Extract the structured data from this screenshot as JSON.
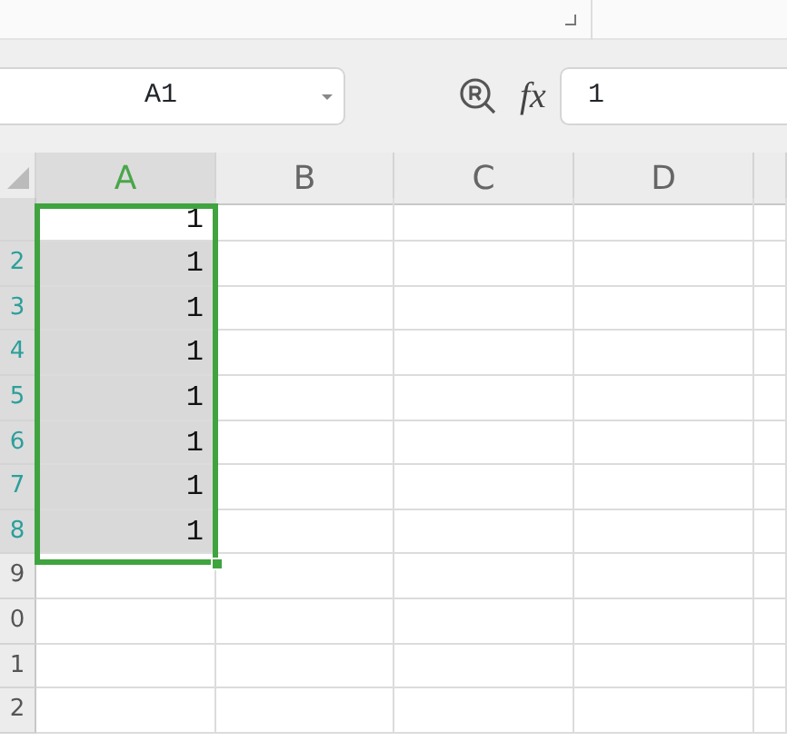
{
  "name_box": {
    "value": "A1"
  },
  "formula_bar": {
    "fx": "fx",
    "value": "1"
  },
  "columns": [
    {
      "label": "A",
      "selected": true
    },
    {
      "label": "B",
      "selected": false
    },
    {
      "label": "C",
      "selected": false
    },
    {
      "label": "D",
      "selected": false
    }
  ],
  "rows": [
    {
      "header": "",
      "active": true,
      "selected": true,
      "cells": [
        "1",
        "",
        "",
        ""
      ]
    },
    {
      "header": "2",
      "active": false,
      "selected": true,
      "cells": [
        "1",
        "",
        "",
        ""
      ]
    },
    {
      "header": "3",
      "active": false,
      "selected": true,
      "cells": [
        "1",
        "",
        "",
        ""
      ]
    },
    {
      "header": "4",
      "active": false,
      "selected": true,
      "cells": [
        "1",
        "",
        "",
        ""
      ]
    },
    {
      "header": "5",
      "active": false,
      "selected": true,
      "cells": [
        "1",
        "",
        "",
        ""
      ]
    },
    {
      "header": "6",
      "active": false,
      "selected": true,
      "cells": [
        "1",
        "",
        "",
        ""
      ]
    },
    {
      "header": "7",
      "active": false,
      "selected": true,
      "cells": [
        "1",
        "",
        "",
        ""
      ]
    },
    {
      "header": "8",
      "active": false,
      "selected": true,
      "cells": [
        "1",
        "",
        "",
        ""
      ]
    },
    {
      "header": "9",
      "active": false,
      "selected": false,
      "cells": [
        "",
        "",
        "",
        ""
      ]
    },
    {
      "header": "0",
      "active": false,
      "selected": false,
      "cells": [
        "",
        "",
        "",
        ""
      ]
    },
    {
      "header": "1",
      "active": false,
      "selected": false,
      "cells": [
        "",
        "",
        "",
        ""
      ]
    },
    {
      "header": "2",
      "active": false,
      "selected": false,
      "cells": [
        "",
        "",
        "",
        ""
      ]
    }
  ]
}
